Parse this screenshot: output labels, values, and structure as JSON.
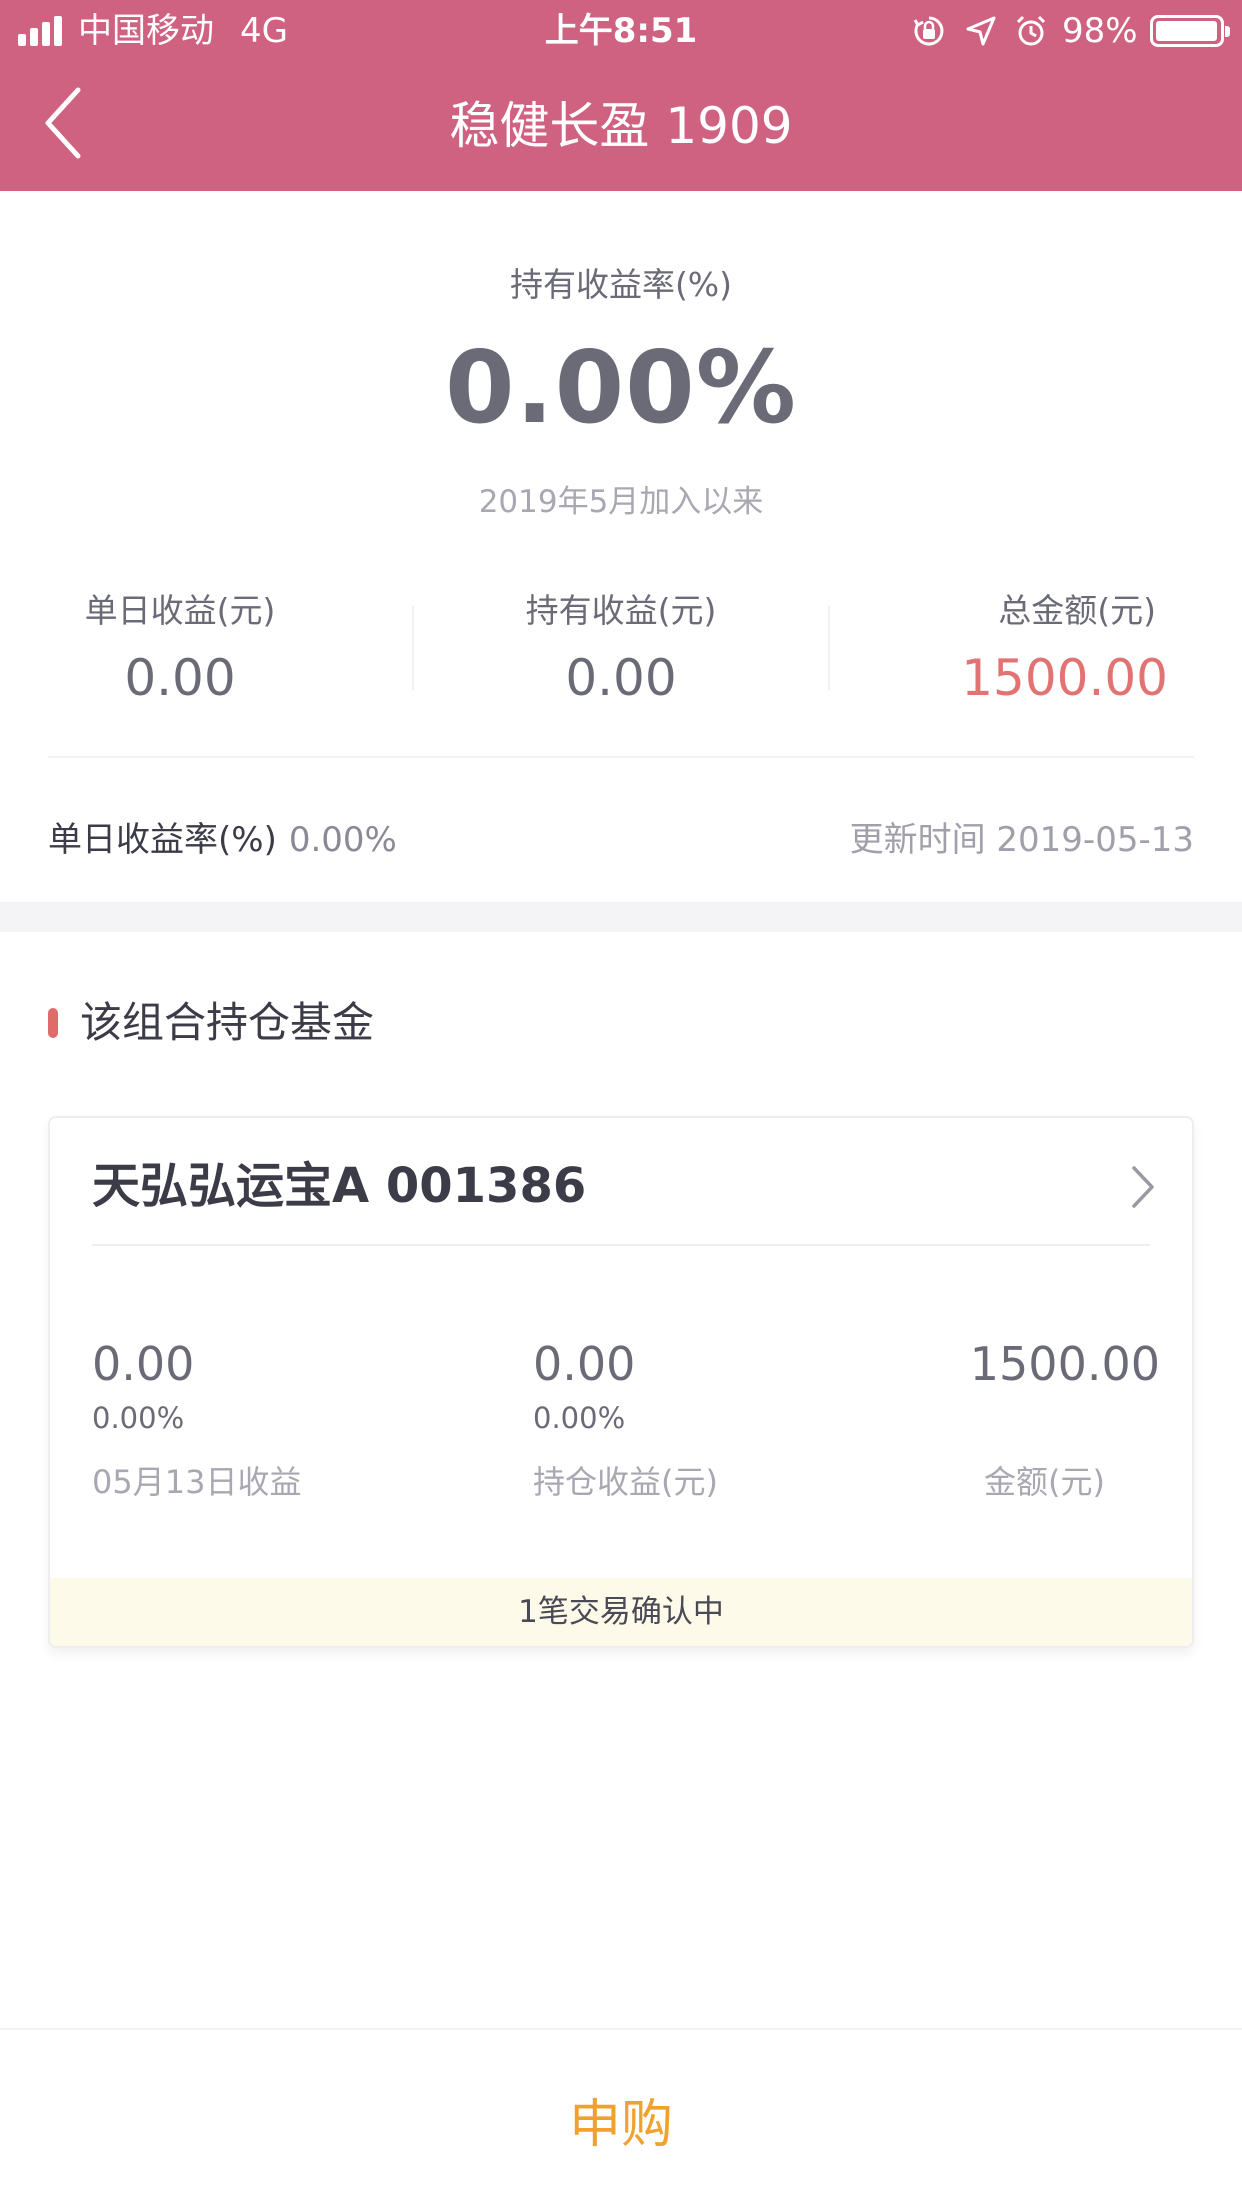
{
  "status_bar": {
    "carrier": "中国移动",
    "network": "4G",
    "time": "上午8:51",
    "battery_percent": "98%",
    "battery_level": 0.98,
    "icons": [
      "signal-icon",
      "rotation-lock-icon",
      "location-icon",
      "alarm-icon",
      "battery-icon"
    ]
  },
  "nav": {
    "title": "稳健长盈 1909",
    "back_icon": "back-chevron-icon"
  },
  "summary": {
    "label": "持有收益率(%)",
    "rate": "0.00%",
    "since": "2019年5月加入以来"
  },
  "stats": [
    {
      "label": "单日收益(元)",
      "value": "0.00"
    },
    {
      "label": "持有收益(元)",
      "value": "0.00"
    },
    {
      "label": "总金额(元)",
      "value": "1500.00"
    }
  ],
  "daily": {
    "label": "单日收益率(%)",
    "value": "0.00%",
    "update_time": "更新时间 2019-05-13"
  },
  "holdings": {
    "section_title": "该组合持仓基金",
    "funds": [
      {
        "name": "天弘弘运宝A 001386",
        "columns": [
          {
            "main": "0.00",
            "sub": "0.00%",
            "caption": "05月13日收益"
          },
          {
            "main": "0.00",
            "sub": "0.00%",
            "caption": "持仓收益(元)"
          },
          {
            "main": "1500.00",
            "caption": "金额(元)"
          }
        ],
        "pending_note": "1笔交易确认中"
      }
    ]
  },
  "actions": {
    "buy_label": "申购"
  },
  "colors": {
    "header": "#cf6181",
    "accent_amount": "#e17373",
    "buy": "#f0a12e",
    "pending_bg": "#fefae9"
  }
}
